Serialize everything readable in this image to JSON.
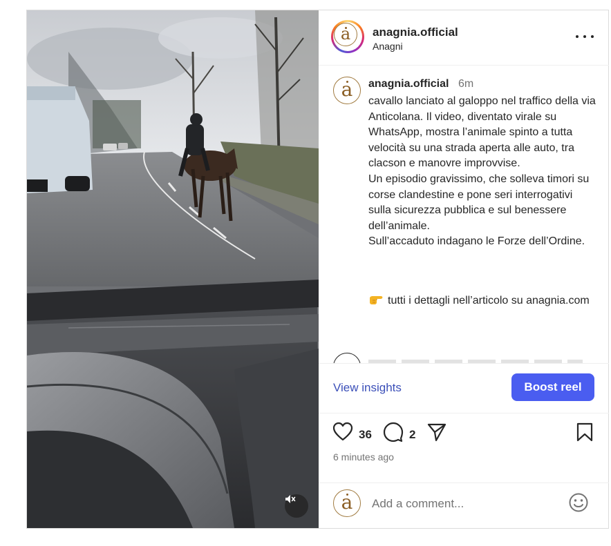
{
  "header": {
    "username": "anagnia.official",
    "location": "Anagni",
    "avatar_letter": "a",
    "more_icon": "more-horizontal-icon"
  },
  "media": {
    "type": "video",
    "mute_icon": "speaker-muted-icon"
  },
  "caption": {
    "username": "anagnia.official",
    "time": "6m",
    "text": "cavallo lanciato al galoppo nel traffico della via Anticolana. Il video, diventato virale su WhatsApp, mostra l’animale spinto a tutta velocità su una strada aperta alle auto, tra clacson e manovre improvvise.\nUn episodio gravissimo, che solleva timori su corse clandestine e pone seri interrogativi sulla sicurezza pubblica e sul benessere dell’animale.\nSull’accaduto indagano le Forze dell’Ordine.",
    "cta_text": "tutti i dettagli nell’articolo su anagnia.com",
    "cta_emoji": "pointing-right-hand-icon"
  },
  "insights": {
    "view_label": "View insights",
    "boost_label": "Boost reel"
  },
  "actions": {
    "likes": "36",
    "comments": "2",
    "time_ago": "6 minutes ago"
  },
  "comment": {
    "placeholder": "Add a comment..."
  },
  "colors": {
    "accent": "#4a5df0",
    "link": "#3b4fb8",
    "text": "#262626",
    "muted": "#737373",
    "avatar_gold": "#8b5e24"
  }
}
